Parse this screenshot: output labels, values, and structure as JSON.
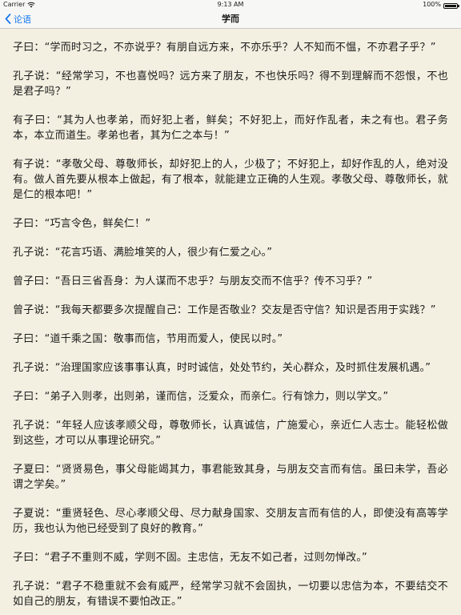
{
  "status_bar": {
    "carrier": "Carrier",
    "time": "9:13 AM",
    "battery": "100%",
    "battery_level": 1.0
  },
  "nav": {
    "back_label": "论语",
    "title": "学而"
  },
  "paragraphs": [
    "子曰：“学而时习之，不亦说乎？有朋自远方来，不亦乐乎？人不知而不愠，不亦君子乎？”",
    "孔子说：“经常学习，不也喜悦吗？远方来了朋友，不也快乐吗？得不到理解而不怨恨，不也是君子吗？”",
    "有子曰：“其为人也孝弟，而好犯上者，鲜矣；不好犯上，而好作乱者，未之有也。君子务本，本立而道生。孝弟也者，其为仁之本与！”",
    "有子说：“孝敬父母、尊敬师长，却好犯上的人，少极了；不好犯上，却好作乱的人，绝对没有。做人首先要从根本上做起，有了根本，就能建立正确的人生观。孝敬父母、尊敬师长，就是仁的根本吧！”",
    "子曰：“巧言令色，鲜矣仁！”",
    "孔子说：“花言巧语、满脸堆笑的人，很少有仁爱之心。”",
    "曾子曰：“吾日三省吾身：为人谋而不忠乎？与朋友交而不信乎？传不习乎？”",
    "曾子说：“我每天都要多次提醒自己：工作是否敬业？交友是否守信？知识是否用于实践？”",
    "子曰：“道千乘之国：敬事而信，节用而爱人，使民以时。”",
    "孔子说：“治理国家应该事事认真，时时诚信，处处节约，关心群众，及时抓住发展机遇。”",
    "子曰：“弟子入则孝，出则弟，谨而信，泛爱众，而亲仁。行有馀力，则以学文。”",
    "孔子说：“年轻人应该孝顺父母，尊敬师长，认真诚信，广施爱心，亲近仁人志士。能轻松做到这些，才可以从事理论研究。”",
    "子夏曰：“贤贤易色，事父母能竭其力，事君能致其身，与朋友交言而有信。虽曰未学，吾必谓之学矣。”",
    "子夏说：“重贤轻色、尽心孝顺父母、尽力献身国家、交朋友言而有信的人，即使没有高等学历，我也认为他已经受到了良好的教育。”",
    "子曰：“君子不重则不威，学则不固。主忠信，无友不如己者，过则勿惮改。”",
    "孔子说：“君子不稳重就不会有威严，经常学习就不会固执，一切要以忠信为本，不要结交不如自己的朋友，有错误不要怕改正。”"
  ]
}
